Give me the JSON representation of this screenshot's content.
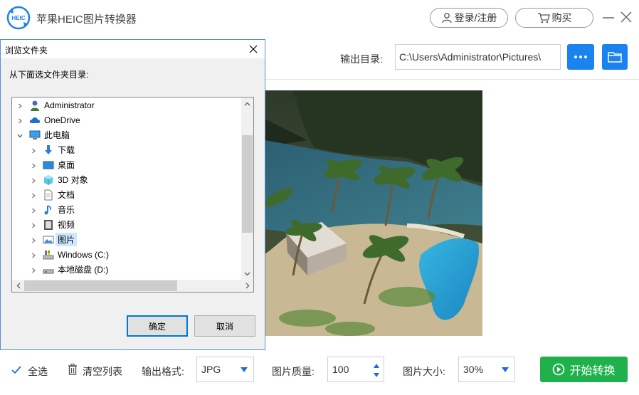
{
  "app": {
    "title": "苹果HEIC图片转换器",
    "logo_text": "HEIC",
    "login_label": "登录/注册",
    "buy_label": "购买"
  },
  "toolbar": {
    "output_label": "输出目录:",
    "output_path": "C:\\Users\\Administrator\\Pictures\\",
    "more_icon": "ellipsis-icon",
    "folder_icon": "folder-icon"
  },
  "bottom": {
    "select_all_label": "全选",
    "clear_label": "清空列表",
    "format_label": "输出格式:",
    "format_value": "JPG",
    "quality_label": "图片质量:",
    "quality_value": "100",
    "size_label": "图片大小:",
    "size_value": "30%",
    "start_label": "开始转换"
  },
  "dialog": {
    "title": "浏览文件夹",
    "prompt": "从下面选文件夹目录:",
    "ok_label": "确定",
    "cancel_label": "取消",
    "tree": [
      {
        "label": "Administrator",
        "icon": "user-icon",
        "level": 0,
        "expanded": false
      },
      {
        "label": "OneDrive",
        "icon": "cloud-icon",
        "level": 0,
        "expanded": false
      },
      {
        "label": "此电脑",
        "icon": "computer-icon",
        "level": 0,
        "expanded": true
      },
      {
        "label": "下载",
        "icon": "download-icon",
        "level": 1,
        "expanded": false
      },
      {
        "label": "桌面",
        "icon": "desktop-icon",
        "level": 1,
        "expanded": false
      },
      {
        "label": "3D 对象",
        "icon": "cube-icon",
        "level": 1,
        "expanded": false
      },
      {
        "label": "文档",
        "icon": "document-icon",
        "level": 1,
        "expanded": false
      },
      {
        "label": "音乐",
        "icon": "music-icon",
        "level": 1,
        "expanded": false
      },
      {
        "label": "视频",
        "icon": "video-icon",
        "level": 1,
        "expanded": false
      },
      {
        "label": "图片",
        "icon": "pictures-icon",
        "level": 1,
        "expanded": false,
        "selected": true
      },
      {
        "label": "Windows (C:)",
        "icon": "system-drive-icon",
        "level": 1,
        "expanded": false
      },
      {
        "label": "本地磁盘 (D:)",
        "icon": "drive-icon",
        "level": 1,
        "expanded": false
      }
    ]
  },
  "colors": {
    "accent_blue": "#1a83f0",
    "start_green": "#1fb14c",
    "selection": "#cce8ff"
  }
}
